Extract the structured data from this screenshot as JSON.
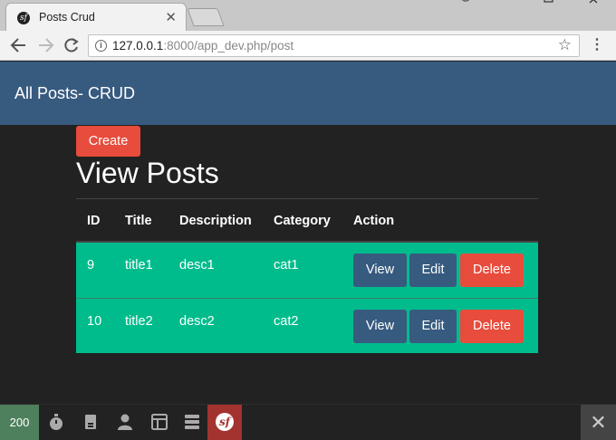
{
  "browser": {
    "tab_title": "Posts Crud",
    "tab_close": "✕",
    "url_host": "127.0.0.1",
    "url_rest": ":8000/app_dev.php/post"
  },
  "navbar": {
    "brand": "All Posts- CRUD"
  },
  "main": {
    "create_label": "Create",
    "title": "View Posts",
    "columns": [
      "ID",
      "Title",
      "Description",
      "Category",
      "Action"
    ],
    "rows": [
      {
        "id": "9",
        "title": "title1",
        "description": "desc1",
        "category": "cat1"
      },
      {
        "id": "10",
        "title": "title2",
        "description": "desc2",
        "category": "cat2"
      }
    ],
    "actions": {
      "view": "View",
      "edit": "Edit",
      "delete": "Delete"
    }
  },
  "debug_toolbar": {
    "status_code": "200"
  },
  "colors": {
    "navbar": "#375a7f",
    "background": "#222222",
    "row": "#00bc8c",
    "danger": "#e74c3c",
    "primary": "#375a7f",
    "status_ok": "#4f805d",
    "symfony": "#a3332f"
  }
}
